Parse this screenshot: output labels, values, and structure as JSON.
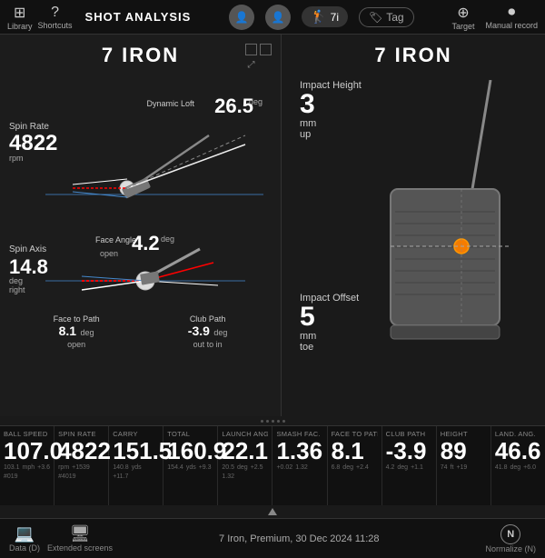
{
  "topbar": {
    "library_label": "Library",
    "shortcuts_label": "Shortcuts",
    "title": "SHOT ANALYSIS",
    "club": "7i",
    "tag_label": "Tag",
    "target_label": "Target",
    "manual_record_label": "Manual record"
  },
  "left_panel": {
    "title": "7 IRON",
    "spin_rate_label": "Spin Rate",
    "spin_rate_value": "4822",
    "spin_rate_unit": "rpm",
    "dynamic_loft_label": "Dynamic Loft",
    "dynamic_loft_value": "26.5",
    "dynamic_loft_deg": "deg",
    "spin_axis_label": "Spin Axis",
    "spin_axis_value": "14.8",
    "spin_axis_unit": "deg\nright",
    "face_angle_label": "Face Angle",
    "face_angle_value": "4.2",
    "face_angle_deg": "deg",
    "face_angle_sub": "open",
    "face_to_path_label": "Face to Path",
    "face_to_path_value": "8.1",
    "face_to_path_deg": "deg",
    "face_to_path_sub": "open",
    "club_path_label": "Club Path",
    "club_path_value": "-3.9",
    "club_path_deg": "deg",
    "club_path_sub": "out to in"
  },
  "right_panel": {
    "title": "7 IRON",
    "impact_height_label": "Impact Height",
    "impact_height_value": "3",
    "impact_height_unit": "mm",
    "impact_height_dir": "up",
    "impact_offset_label": "Impact Offset",
    "impact_offset_value": "5",
    "impact_offset_unit": "mm",
    "impact_offset_dir": "toe"
  },
  "stats": [
    {
      "label": "BALL SPEED",
      "value": "107.0",
      "subs": [
        "103.1",
        "mph",
        "+3.6",
        "#019"
      ]
    },
    {
      "label": "SPIN RATE",
      "value": "4822",
      "subs": [
        "rpm",
        "+1539",
        "#4019"
      ]
    },
    {
      "label": "CARRY",
      "value": "151.5",
      "subs": [
        "140.8",
        "yds",
        "+11.7"
      ]
    },
    {
      "label": "TOTAL",
      "value": "160.9",
      "subs": [
        "154.4",
        "yds",
        "+9.3"
      ]
    },
    {
      "label": "LAUNCH ANG.",
      "value": "22.1",
      "subs": [
        "20.5",
        "deg",
        "+2.5",
        "1.32"
      ]
    },
    {
      "label": "SMASH FAC.",
      "value": "1.36",
      "subs": [
        "+0.02",
        "1.32"
      ]
    },
    {
      "label": "FACE TO PATH",
      "value": "8.1",
      "subs": [
        "6.8",
        "deg",
        "+2.4"
      ]
    },
    {
      "label": "CLUB PATH",
      "value": "-3.9",
      "subs": [
        "4.2",
        "deg",
        "+1.1"
      ]
    },
    {
      "label": "HEIGHT",
      "value": "89",
      "subs": [
        "74",
        "ft",
        "+19"
      ]
    },
    {
      "label": "LAND. ANG.",
      "value": "46.6",
      "subs": [
        "41.8",
        "deg",
        "+6.0"
      ]
    }
  ],
  "bottom": {
    "session_label": "7 Iron, Premium, 30 Dec 2024 11:28",
    "data_btn": "Data (D)",
    "screens_btn": "Extended screens",
    "normalize_label": "Normalize (N)"
  }
}
